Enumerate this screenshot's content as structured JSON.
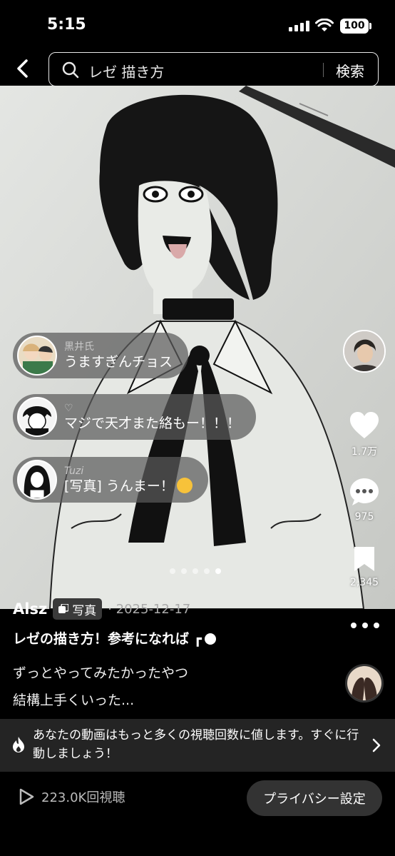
{
  "status_bar": {
    "time": "5:15",
    "battery": "100"
  },
  "search": {
    "query": "レゼ 描き方",
    "button_label": "検索"
  },
  "comments": [
    {
      "user": "黒井氏",
      "text": "うますぎんチョス"
    },
    {
      "user": "♡",
      "text": "マジで天才また絡もー！！！"
    },
    {
      "user": "Tuzi",
      "text": "[写真] うんまー！"
    }
  ],
  "actions": {
    "likes": "1.7万",
    "comments": "975",
    "saves": "2,345"
  },
  "carousel": {
    "count": 5,
    "active": 5
  },
  "post": {
    "author": "Alsz",
    "type_label": "写真",
    "date": "· 2025-12-17",
    "title": "レゼの描き方！参考になれば ┏",
    "desc_lines": [
      "ずっとやってみたかったやつ",
      "結構上手くいった..."
    ]
  },
  "promo": {
    "text": "あなたの動画はもっと多くの視聴回数に値します。すぐに行動しましょう！"
  },
  "footer": {
    "views": "223.0K回視聴",
    "privacy_label": "プライバシー設定"
  },
  "colors": {
    "background": "#000000",
    "bubble": "#5a5a5a",
    "promo_bg": "#242424",
    "button_bg": "#333333"
  },
  "icons": [
    "chevron-left-icon",
    "search-icon",
    "heart-icon",
    "comment-icon",
    "bookmark-icon",
    "more-icon",
    "flame-icon",
    "chevron-right-icon",
    "play-icon"
  ]
}
